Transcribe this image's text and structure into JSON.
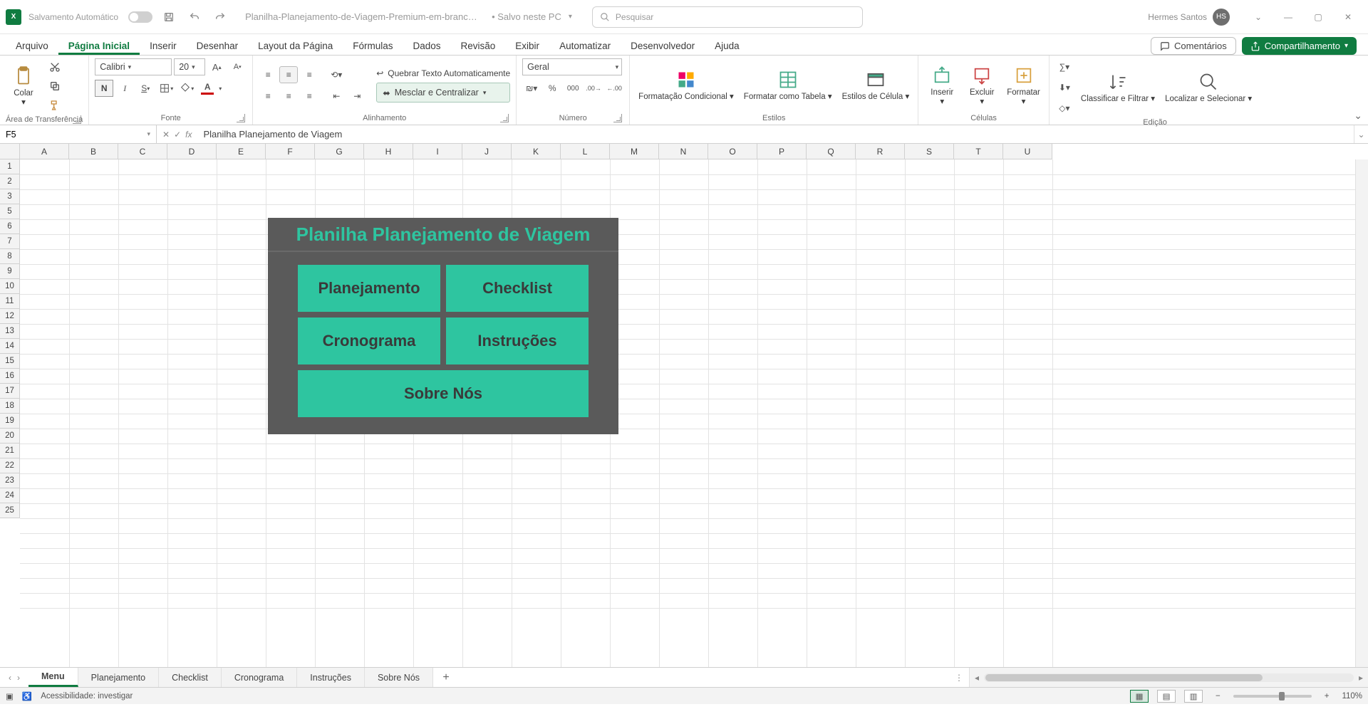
{
  "titlebar": {
    "autosave_label": "Salvamento Automático",
    "filename": "Planilha-Planejamento-de-Viagem-Premium-em-branco....",
    "save_state": "• Salvo neste PC",
    "search_placeholder": "Pesquisar",
    "user_name": "Hermes Santos",
    "user_initials": "HS"
  },
  "ribbon_tabs": {
    "items": [
      "Arquivo",
      "Página Inicial",
      "Inserir",
      "Desenhar",
      "Layout da Página",
      "Fórmulas",
      "Dados",
      "Revisão",
      "Exibir",
      "Automatizar",
      "Desenvolvedor",
      "Ajuda"
    ],
    "active_index": 1,
    "comments_label": "Comentários",
    "share_label": "Compartilhamento"
  },
  "ribbon": {
    "clipboard": {
      "paste": "Colar",
      "group": "Área de Transferência"
    },
    "font": {
      "name": "Calibri",
      "size": "20",
      "group": "Fonte"
    },
    "alignment": {
      "wrap": "Quebrar Texto Automaticamente",
      "merge": "Mesclar e Centralizar",
      "group": "Alinhamento"
    },
    "number": {
      "format": "Geral",
      "group": "Número"
    },
    "styles": {
      "cond": "Formatação Condicional",
      "table": "Formatar como Tabela",
      "cell": "Estilos de Célula",
      "group": "Estilos"
    },
    "cells": {
      "insert": "Inserir",
      "delete": "Excluir",
      "format": "Formatar",
      "group": "Células"
    },
    "editing": {
      "sort": "Classificar e Filtrar",
      "find": "Localizar e Selecionar",
      "group": "Edição"
    }
  },
  "formula_bar": {
    "cell_ref": "F5",
    "formula": "Planilha Planejamento de Viagem"
  },
  "grid": {
    "cols": [
      "A",
      "B",
      "C",
      "D",
      "E",
      "F",
      "G",
      "H",
      "I",
      "J",
      "K",
      "L",
      "M",
      "N",
      "O",
      "P",
      "Q",
      "R",
      "S",
      "T",
      "U"
    ],
    "rows": [
      "1",
      "2",
      "3",
      "5",
      "6",
      "7",
      "8",
      "9",
      "10",
      "11",
      "12",
      "13",
      "14",
      "15",
      "16",
      "17",
      "18",
      "19",
      "20",
      "21",
      "22",
      "23",
      "24",
      "25"
    ]
  },
  "menu_card": {
    "title": "Planilha Planejamento de Viagem",
    "cells": {
      "planejamento": "Planejamento",
      "checklist": "Checklist",
      "cronograma": "Cronograma",
      "instrucoes": "Instruções",
      "sobre": "Sobre Nós"
    }
  },
  "sheet_tabs": {
    "items": [
      "Menu",
      "Planejamento",
      "Checklist",
      "Cronograma",
      "Instruções",
      "Sobre Nós"
    ],
    "active_index": 0
  },
  "statusbar": {
    "accessibility": "Acessibilidade: investigar",
    "zoom": "110%"
  }
}
